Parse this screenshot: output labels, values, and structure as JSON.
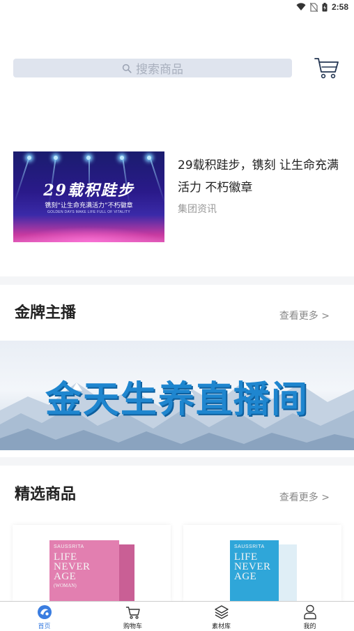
{
  "status_bar": {
    "time": "2:58"
  },
  "search": {
    "placeholder": "搜索商品"
  },
  "news": {
    "title": "29载积跬步，镌刻 让生命充满活力 不朽徽章",
    "category": "集团资讯",
    "image": {
      "headline": "29载积跬步",
      "subline": "镌刻“让生命充满活力”不朽徽章",
      "english": "GOLDEN DAYS MAKE LIFE FULL OF VITALITY"
    }
  },
  "anchors": {
    "title": "金牌主播",
    "more": "查看更多 >",
    "banner_text": "金天生养直播间"
  },
  "featured": {
    "title": "精选商品",
    "more": "查看更多 >",
    "products": [
      {
        "brand": "SAUSSRITA",
        "name_lines": [
          "LIFE",
          "NEVER",
          "AGE"
        ],
        "variant": "(WOMAN)",
        "color": "#e27fb0"
      },
      {
        "brand": "SAUSSRITA",
        "name_lines": [
          "LIFE",
          "NEVER",
          "AGE"
        ],
        "variant": "",
        "color": "#2fa6d9"
      }
    ]
  },
  "bottom_nav": {
    "items": [
      {
        "label": "首页",
        "active": true
      },
      {
        "label": "购物车",
        "active": false
      },
      {
        "label": "素材库",
        "active": false
      },
      {
        "label": "我的",
        "active": false
      }
    ]
  }
}
